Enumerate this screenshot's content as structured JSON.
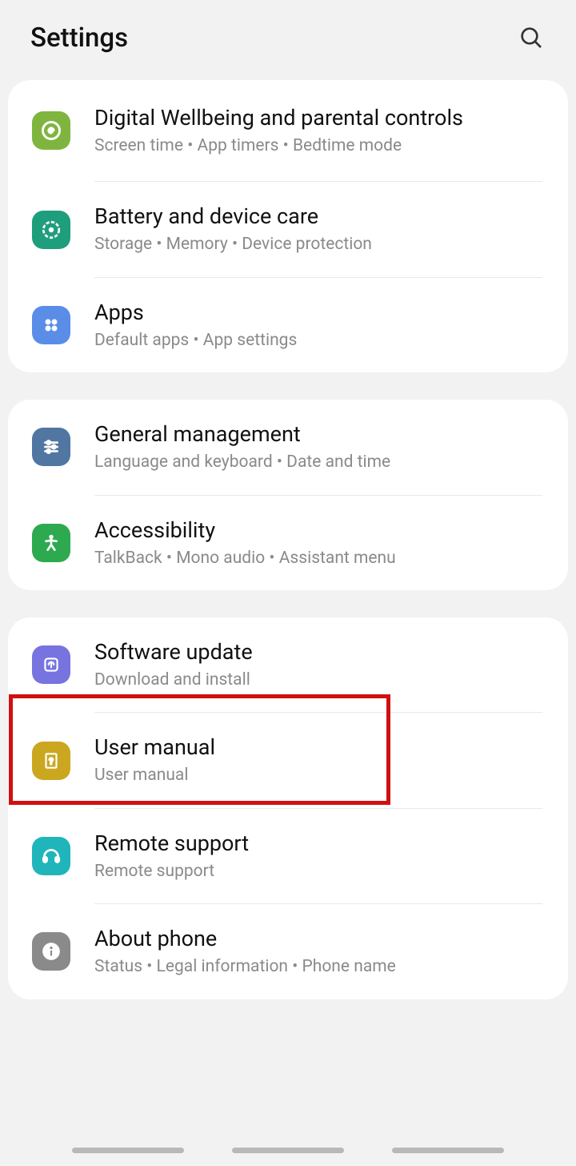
{
  "header": {
    "title": "Settings"
  },
  "groups": [
    {
      "items": [
        {
          "id": "digital-wellbeing",
          "title": "Digital Wellbeing and parental controls",
          "subtitle": "Screen time  •  App timers  •  Bedtime mode",
          "icon_color": "icon-green"
        },
        {
          "id": "battery-device-care",
          "title": "Battery and device care",
          "subtitle": "Storage  •  Memory  •  Device protection",
          "icon_color": "icon-teal"
        },
        {
          "id": "apps",
          "title": "Apps",
          "subtitle": "Default apps  •  App settings",
          "icon_color": "icon-blue"
        }
      ]
    },
    {
      "items": [
        {
          "id": "general-management",
          "title": "General management",
          "subtitle": "Language and keyboard  •  Date and time",
          "icon_color": "icon-darkblue"
        },
        {
          "id": "accessibility",
          "title": "Accessibility",
          "subtitle": "TalkBack  •  Mono audio  •  Assistant menu",
          "icon_color": "icon-green2"
        }
      ]
    },
    {
      "items": [
        {
          "id": "software-update",
          "title": "Software update",
          "subtitle": "Download and install",
          "icon_color": "icon-purple"
        },
        {
          "id": "user-manual",
          "title": "User manual",
          "subtitle": "User manual",
          "icon_color": "icon-olive"
        },
        {
          "id": "remote-support",
          "title": "Remote support",
          "subtitle": "Remote support",
          "icon_color": "icon-cyan"
        },
        {
          "id": "about-phone",
          "title": "About phone",
          "subtitle": "Status  •  Legal information  •  Phone name",
          "icon_color": "icon-gray"
        }
      ]
    }
  ]
}
